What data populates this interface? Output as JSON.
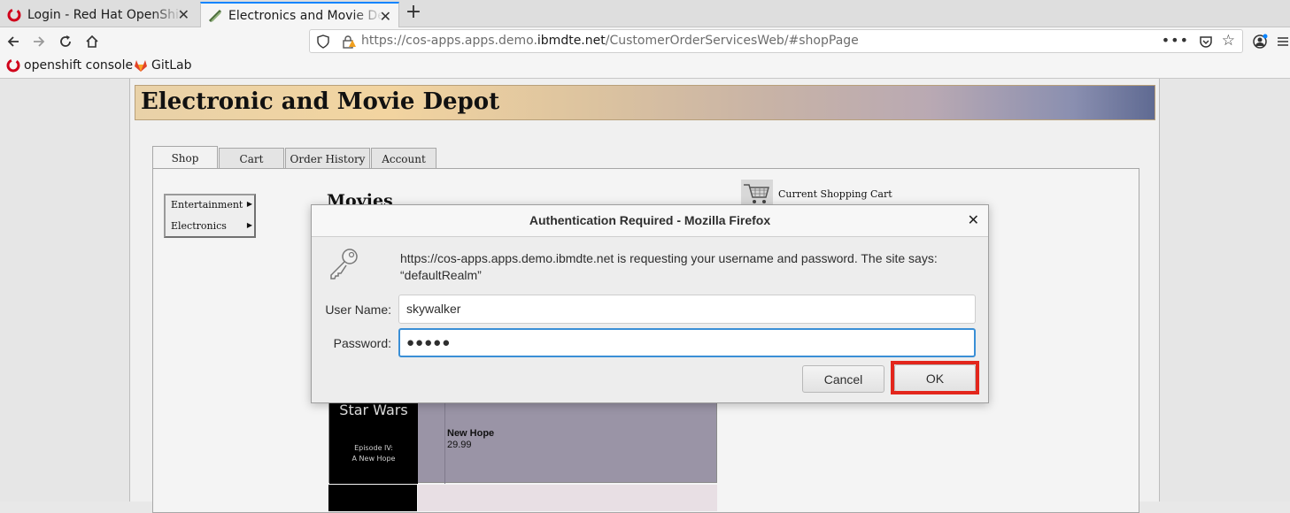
{
  "browser": {
    "tabs": [
      {
        "title": "Login - Red Hat OpenShift",
        "active": false
      },
      {
        "title": "Electronics and Movie Depot",
        "active": true
      }
    ],
    "new_tab": "+",
    "url_prefix": "https://cos-apps.apps.demo.",
    "url_domain": "ibmdte.net",
    "url_path": "/CustomerOrderServicesWeb/#shopPage",
    "url_menu": "•••",
    "bookmarks": [
      "openshift console",
      "GitLab"
    ],
    "close_glyph": "✕"
  },
  "page": {
    "banner_title": "Electronic and Movie Depot",
    "tabs": [
      "Shop",
      "Cart",
      "Order History",
      "Account"
    ],
    "active_tab": "Shop",
    "categories": [
      "Entertainment",
      "Electronics"
    ],
    "section_title": "Movies",
    "cart_label": "Current Shopping Cart",
    "product": {
      "poster_title": "Star Wars",
      "poster_subtitle_1": "Episode IV:",
      "poster_subtitle_2": "A New Hope",
      "name": "New Hope",
      "price": "29.99"
    }
  },
  "dialog": {
    "title": "Authentication Required - Mozilla Firefox",
    "close_glyph": "✕",
    "message_line1": "https://cos-apps.apps.demo.ibmdte.net is requesting your username and password. The site says:",
    "message_line2": "“defaultRealm”",
    "username_label": "User Name:",
    "username_value": "skywalker",
    "password_label": "Password:",
    "password_value": "●●●●●",
    "cancel_label": "Cancel",
    "ok_label": "OK",
    "highlight_color": "#e3261c"
  }
}
